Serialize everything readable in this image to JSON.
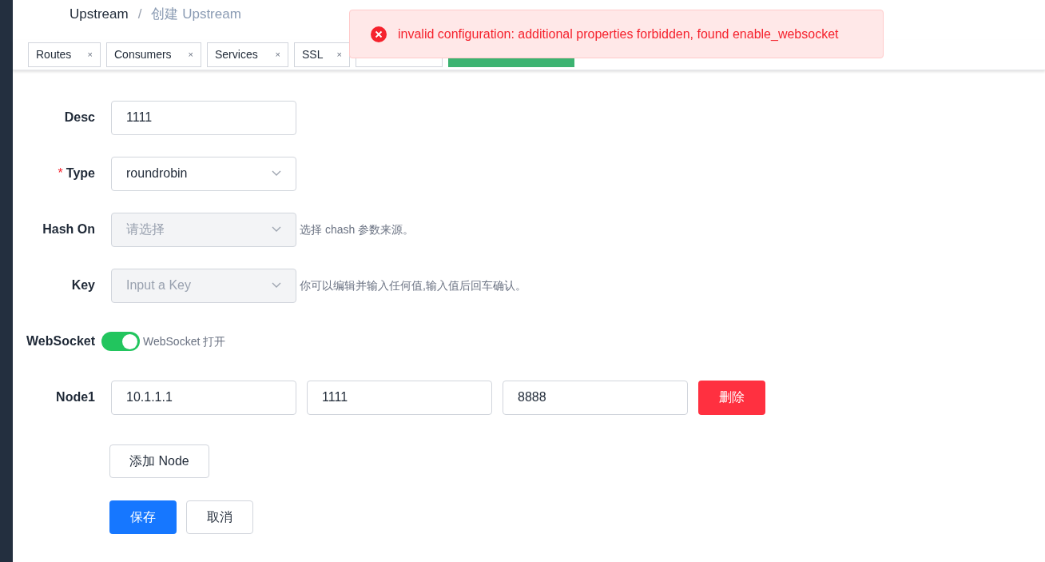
{
  "breadcrumb": [
    {
      "label": "Upstream",
      "current": false
    },
    {
      "separator": "/",
      "label": "创建 Upstream",
      "current": true
    }
  ],
  "tabs": [
    {
      "label": "Routes",
      "kind": "tab",
      "close": "×"
    },
    {
      "label": "Consumers",
      "kind": "tab",
      "close": "×"
    },
    {
      "label": "Services",
      "kind": "tab",
      "close": "×"
    },
    {
      "label": "SSL",
      "kind": "tab",
      "close": "×"
    },
    {
      "kind": "covered"
    },
    {
      "kind": "covered_active"
    }
  ],
  "toast": {
    "message": "invalid configuration: additional properties forbidden, found enable_websocket"
  },
  "form": [
    {
      "kind": "input",
      "label": "Desc",
      "value": "1111"
    },
    {
      "kind": "select",
      "label": "Type",
      "required_mark": "*",
      "value": "roundrobin",
      "disabled": false
    },
    {
      "kind": "select",
      "label": "Hash On",
      "placeholder": "请选择",
      "disabled": true,
      "help": "选择 chash 参数来源。"
    },
    {
      "kind": "select",
      "label": "Key",
      "placeholder": "Input a Key",
      "disabled": true,
      "help": "你可以编辑并输入任何值,输入值后回车确认。"
    },
    {
      "kind": "switch",
      "label": "WebSocket",
      "on": true,
      "help": "WebSocket 打开"
    },
    {
      "kind": "node",
      "label": "Node1",
      "values": [
        "10.1.1.1",
        "1111",
        "8888"
      ],
      "delete": "删除"
    }
  ],
  "add_node": "添加 Node",
  "buttons": [
    {
      "label": "保存",
      "primary": true
    },
    {
      "label": "取消",
      "primary": false
    }
  ]
}
